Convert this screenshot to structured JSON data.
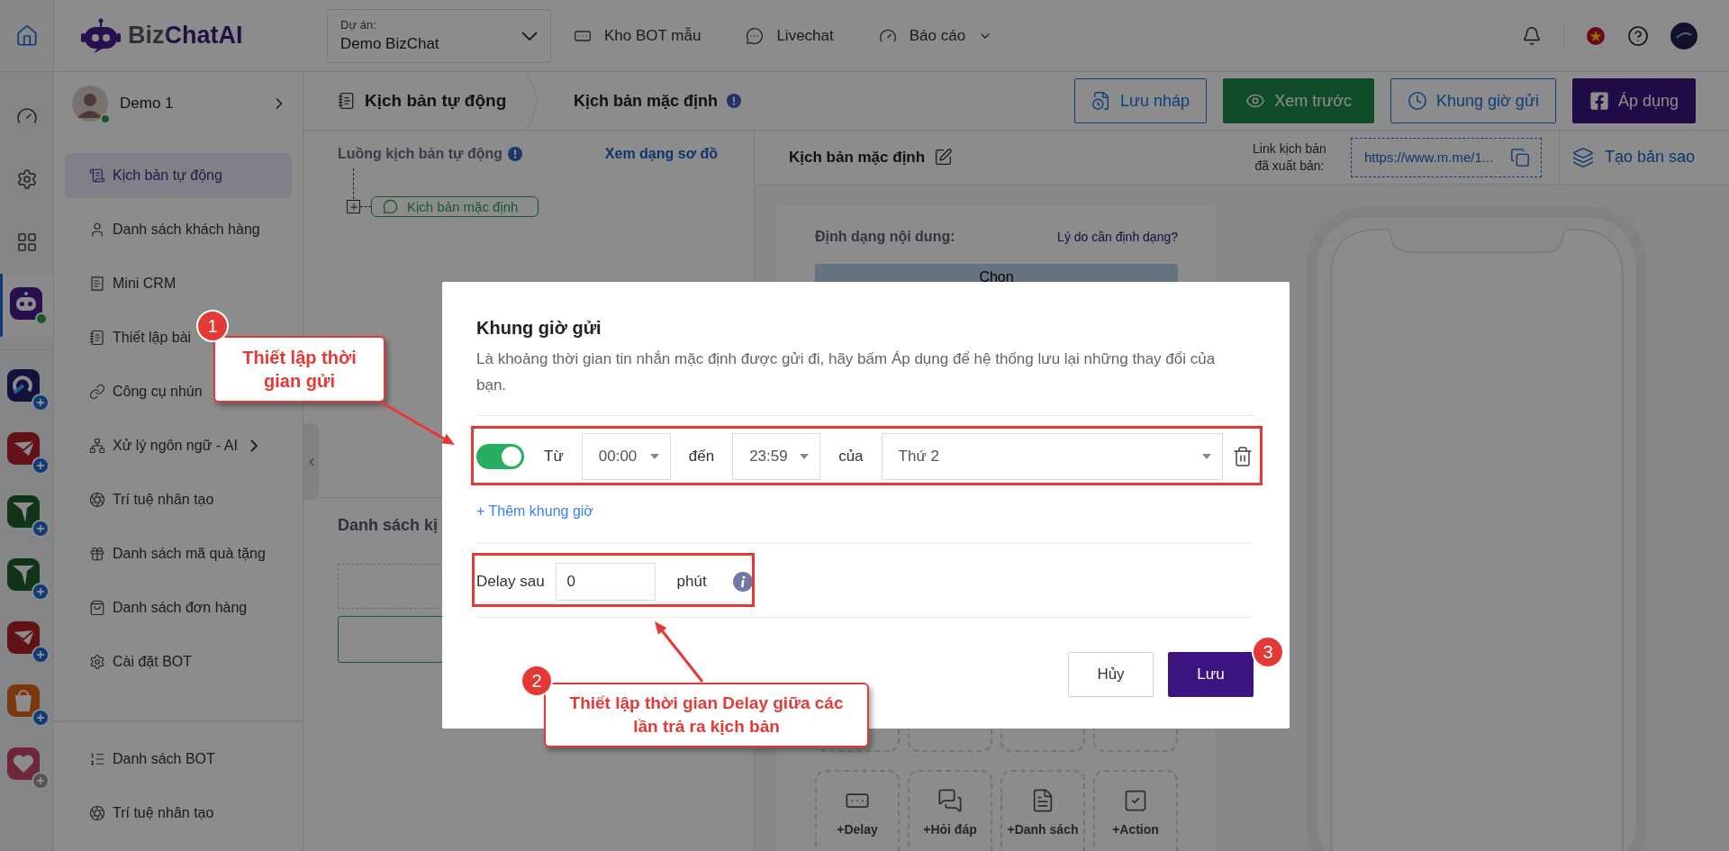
{
  "rail": {
    "items": [
      {
        "kind": "gauge",
        "selected": false
      },
      {
        "kind": "gear",
        "selected": false
      },
      {
        "kind": "grid",
        "selected": false
      },
      {
        "kind": "bot",
        "selected": true
      }
    ],
    "apps": [
      {
        "kind": "orbit",
        "added": true
      },
      {
        "kind": "mail",
        "added": true
      },
      {
        "kind": "plane",
        "added": true
      },
      {
        "kind": "plane",
        "added": true
      },
      {
        "kind": "mail",
        "added": true
      },
      {
        "kind": "bag",
        "added": true
      },
      {
        "kind": "heart",
        "added": false
      }
    ]
  },
  "header": {
    "logo": "BizChatAI",
    "project": {
      "label": "Dự án:",
      "value": "Demo BizChat"
    },
    "nav": [
      {
        "label": "Kho BOT mẫu",
        "kind": "robot",
        "dropdown": false
      },
      {
        "label": "Livechat",
        "kind": "chat",
        "dropdown": false
      },
      {
        "label": "Báo cáo",
        "kind": "gauge",
        "dropdown": true
      }
    ]
  },
  "user": {
    "name": "Demo 1",
    "online": true
  },
  "menu": [
    {
      "label": "Kịch bản tự động",
      "selected": true,
      "expandable": false
    },
    {
      "label": "Danh sách khách hàng",
      "selected": false,
      "expandable": false
    },
    {
      "label": "Mini CRM",
      "selected": false,
      "expandable": false
    },
    {
      "label": "Thiết lập bài",
      "selected": false,
      "expandable": false
    },
    {
      "label": "Công cụ nhún",
      "selected": false
    },
    {
      "label": "Xử lý ngôn ngữ - AI",
      "selected": false,
      "expandable": true
    },
    {
      "label": "Trí tuệ nhân tạo",
      "selected": false,
      "expandable": false
    },
    {
      "label": "Danh sách mã quà tặng",
      "selected": false,
      "expandable": false
    },
    {
      "label": "Danh sách đơn hàng",
      "selected": false,
      "expandable": false
    },
    {
      "label": "Cài đặt BOT",
      "selected": false,
      "expandable": false
    }
  ],
  "menu_bottom": [
    {
      "label": "Danh sách BOT"
    },
    {
      "label": "Trí tuệ nhân tạo"
    }
  ],
  "breadcrumb": [
    {
      "label": "Kịch bản tự động",
      "info": false
    },
    {
      "label": "Kịch bản mặc định",
      "info": true
    }
  ],
  "actions": [
    {
      "label": "Lưu nháp",
      "kind": "outline"
    },
    {
      "label": "Xem trước",
      "kind": "green"
    },
    {
      "label": "Khung giờ gửi",
      "kind": "outline"
    },
    {
      "label": "Áp dụng",
      "kind": "primary"
    }
  ],
  "flow": {
    "title": "Luồng kịch bản tự động",
    "link": "Xem dạng sơ đồ",
    "node": "Kịch bản mặc định",
    "list_title": "Danh sách kị"
  },
  "editor": {
    "title": "Kịch bản mặc định",
    "link_label": "Link kịch bản đã xuất bản:",
    "link": "https://www.m.me/1...",
    "copy": "Tạo bản sao",
    "format_label": "Định dạng nội dung:",
    "format_help": "Lý do cần định dạng?",
    "format_value": "Chọn",
    "blocks": [
      "+Delay",
      "+Hỏi đáp",
      "+Danh sách",
      "+Action"
    ]
  },
  "modal": {
    "title": "Khung giờ gửi",
    "description": "Là khoảng thời gian tin nhắn mặc định được gửi đi, hãy bấm Áp dụng để hệ thống lưu lại những thay đổi của bạn.",
    "slots": [
      {
        "enabled": true,
        "from_label": "Từ",
        "from": "00:00",
        "to_label": "đến",
        "to": "23:59",
        "day_label": "của",
        "day": "Thứ 2"
      }
    ],
    "add": "+ Thêm khung giờ",
    "delay": {
      "label": "Delay sau",
      "value": "0",
      "unit": "phút"
    },
    "buttons": [
      {
        "label": "Hủy",
        "kind": "cancel"
      },
      {
        "label": "Lưu",
        "kind": "primary"
      }
    ]
  },
  "annotations": [
    {
      "number": "1",
      "text": "Thiết lập thời gian gửi"
    },
    {
      "number": "2",
      "text": "Thiết lập thời gian Delay giữa các lần trả ra kịch bản"
    },
    {
      "number": "3"
    }
  ]
}
